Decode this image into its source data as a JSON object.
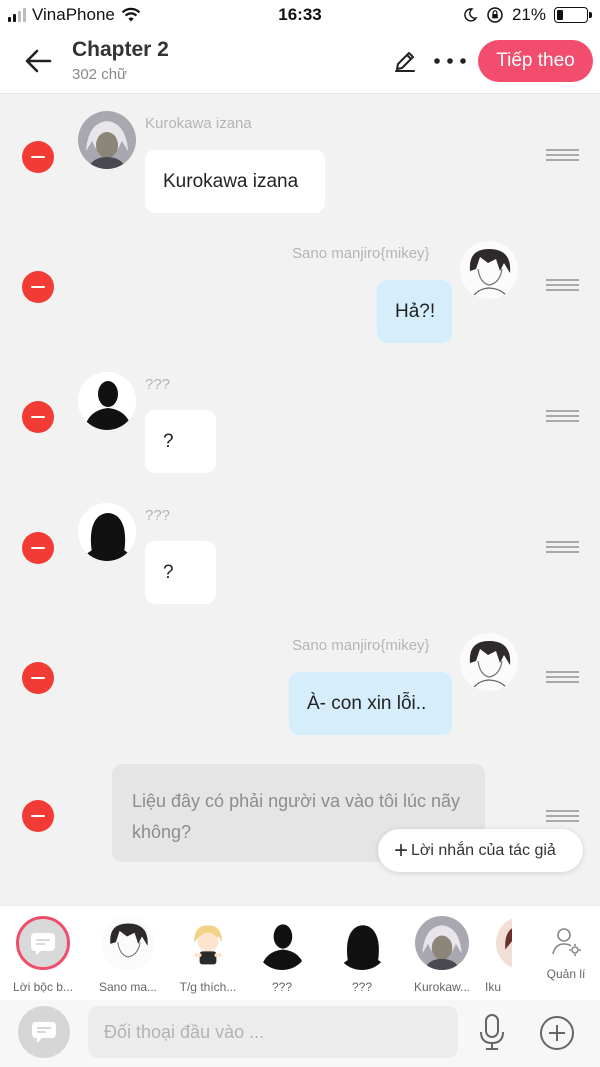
{
  "status_bar": {
    "carrier": "VinaPhone",
    "time": "16:33",
    "battery": "21%",
    "battery_level": 0.21
  },
  "header": {
    "title": "Chapter 2",
    "word_count": "302 chữ",
    "next_label": "Tiếp theo"
  },
  "messages": [
    {
      "name": "Kurokawa izana",
      "text": "Kurokawa izana"
    },
    {
      "name": "Sano manjiro{mikey}",
      "text": "Hả?!"
    },
    {
      "name": "???",
      "text": "?"
    },
    {
      "name": "???",
      "text": "?"
    },
    {
      "name": "Sano manjiro{mikey}",
      "text": "À- con xin lỗi.."
    }
  ],
  "narration": {
    "text": "Liệu đây có phải người va vào tôi lúc nãy không?"
  },
  "author_note_label": "Lời nhắn của tác giả",
  "characters": [
    {
      "label": "Lời bộc b..."
    },
    {
      "label": "Sano ma..."
    },
    {
      "label": "T/g thích..."
    },
    {
      "label": "???"
    },
    {
      "label": "???"
    },
    {
      "label": "Kurokaw..."
    },
    {
      "label": "Iku"
    }
  ],
  "manage_label": "Quản lí",
  "input": {
    "placeholder": "Đối thoại đầu vào ..."
  },
  "colors": {
    "accent": "#f34d6e",
    "delete": "#f23b34",
    "bubble_blue": "#d6eefb"
  },
  "icons": [
    "back-arrow-icon",
    "pencil-icon",
    "more-icon",
    "minus-icon",
    "drag-handle-icon",
    "chat-bubble-icon",
    "person-gear-icon",
    "microphone-icon",
    "plus-circle-icon"
  ]
}
